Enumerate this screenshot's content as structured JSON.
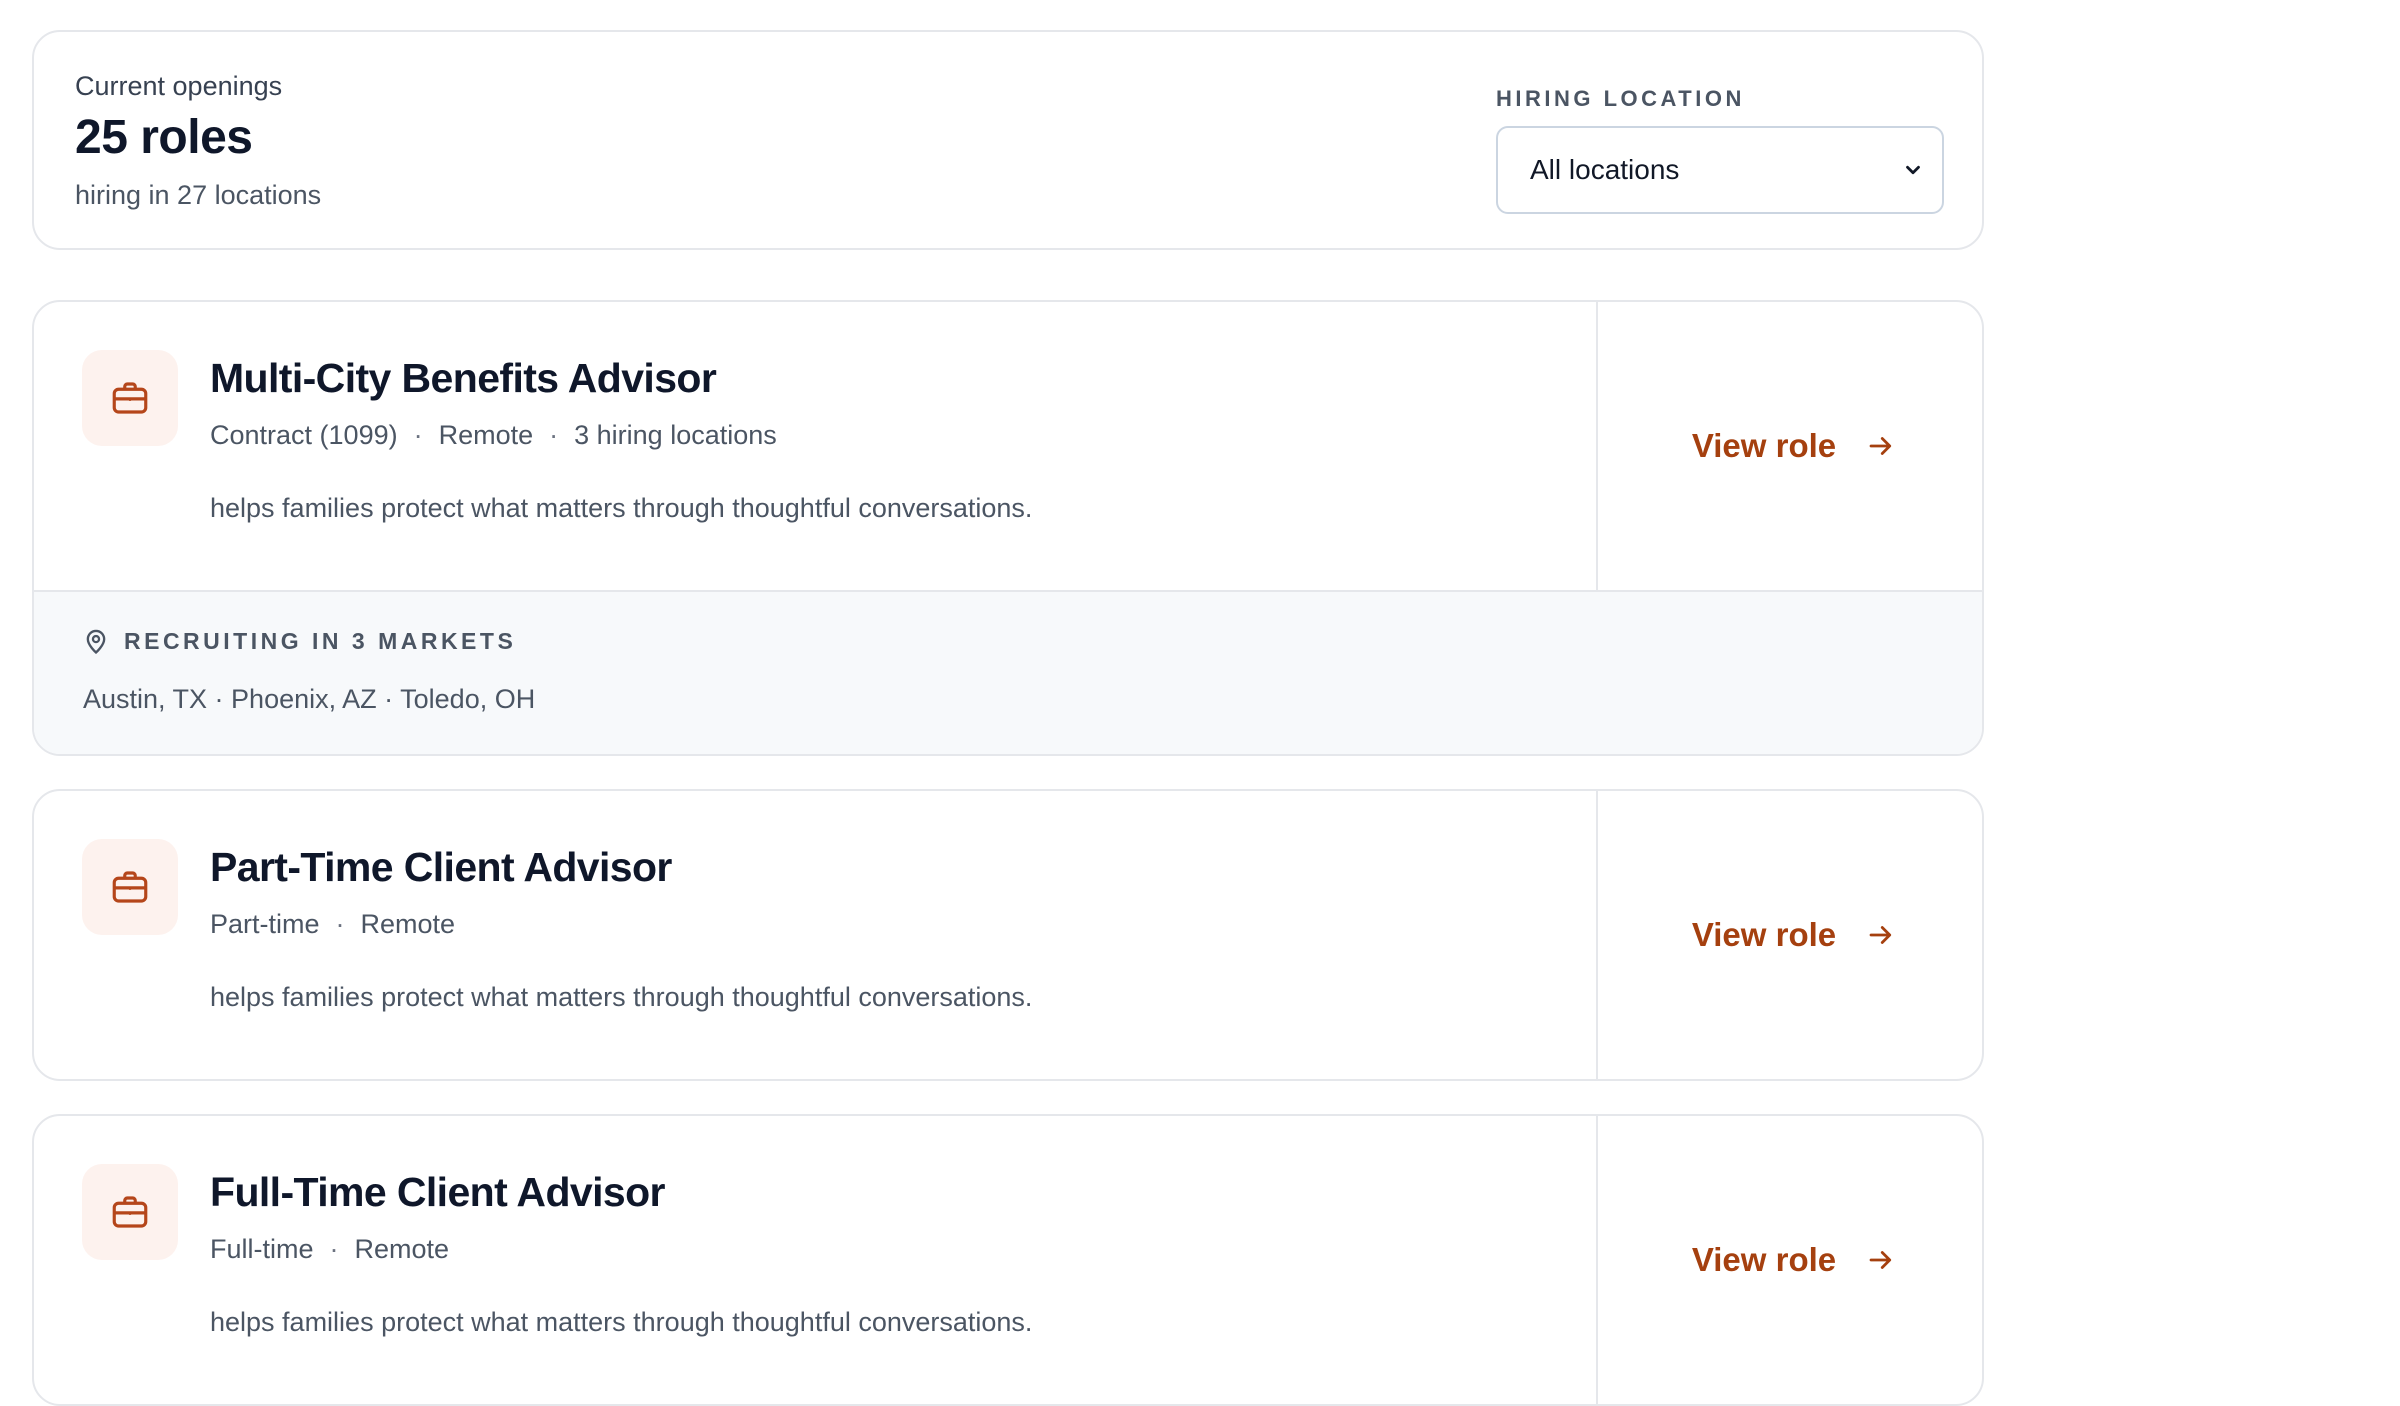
{
  "summary": {
    "label": "Current openings",
    "count": "25 roles",
    "sub": "hiring in 27 locations"
  },
  "filter": {
    "label": "HIRING LOCATION",
    "selected": "All locations"
  },
  "colors": {
    "accent": "#a5400f",
    "icon_bg": "#fdf2ee",
    "border": "#e5e7eb",
    "markets_bg": "#f7f9fb"
  },
  "jobs": [
    {
      "title": "Multi-City Benefits Advisor",
      "meta": [
        "Contract (1099)",
        "Remote",
        "3 hiring locations"
      ],
      "description": "helps families protect what matters through thoughtful conversations.",
      "action": "View role",
      "markets_label": "RECRUITING IN 3 MARKETS",
      "markets": "Austin, TX · Phoenix, AZ · Toledo, OH"
    },
    {
      "title": "Part-Time Client Advisor",
      "meta": [
        "Part-time",
        "Remote"
      ],
      "description": "helps families protect what matters through thoughtful conversations.",
      "action": "View role"
    },
    {
      "title": "Full-Time Client Advisor",
      "meta": [
        "Full-time",
        "Remote"
      ],
      "description": "helps families protect what matters through thoughtful conversations.",
      "action": "View role"
    }
  ]
}
